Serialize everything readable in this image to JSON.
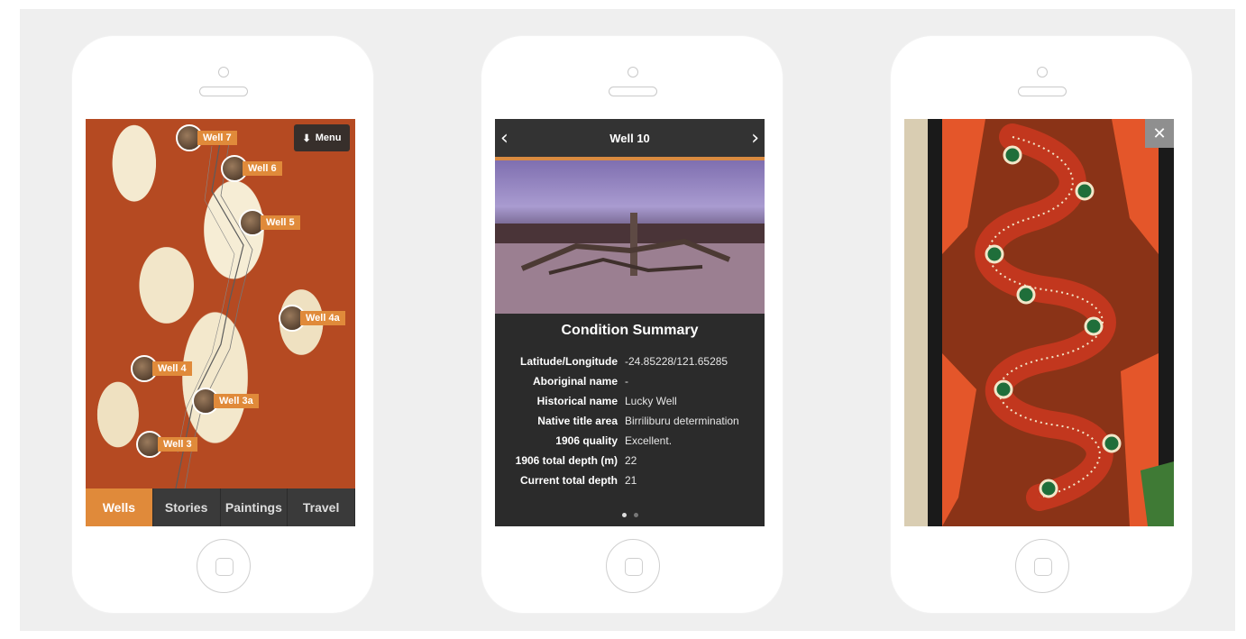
{
  "screen1": {
    "menu_label": "Menu",
    "wells": [
      {
        "label": "Well 7"
      },
      {
        "label": "Well 6"
      },
      {
        "label": "Well 5"
      },
      {
        "label": "Well 4a"
      },
      {
        "label": "Well 4"
      },
      {
        "label": "Well 3a"
      },
      {
        "label": "Well 3"
      }
    ],
    "tabs": [
      {
        "label": "Wells",
        "active": true
      },
      {
        "label": "Stories",
        "active": false
      },
      {
        "label": "Paintings",
        "active": false
      },
      {
        "label": "Travel",
        "active": false
      }
    ]
  },
  "screen2": {
    "title": "Well 10",
    "summary_title": "Condition Summary",
    "rows": [
      {
        "key": "Latitude/Longitude",
        "value": "-24.85228/121.65285"
      },
      {
        "key": "Aboriginal name",
        "value": "-"
      },
      {
        "key": "Historical name",
        "value": "Lucky Well"
      },
      {
        "key": "Native title area",
        "value": "Birriliburu determination"
      },
      {
        "key": "1906 quality",
        "value": "Excellent."
      },
      {
        "key": "1906 total depth (m)",
        "value": "22"
      },
      {
        "key": "Current total depth",
        "value": "21"
      }
    ],
    "page_index": 0,
    "page_count": 2
  },
  "colors": {
    "accent": "#e08a3a",
    "dark_bar": "#3a3a3a"
  }
}
